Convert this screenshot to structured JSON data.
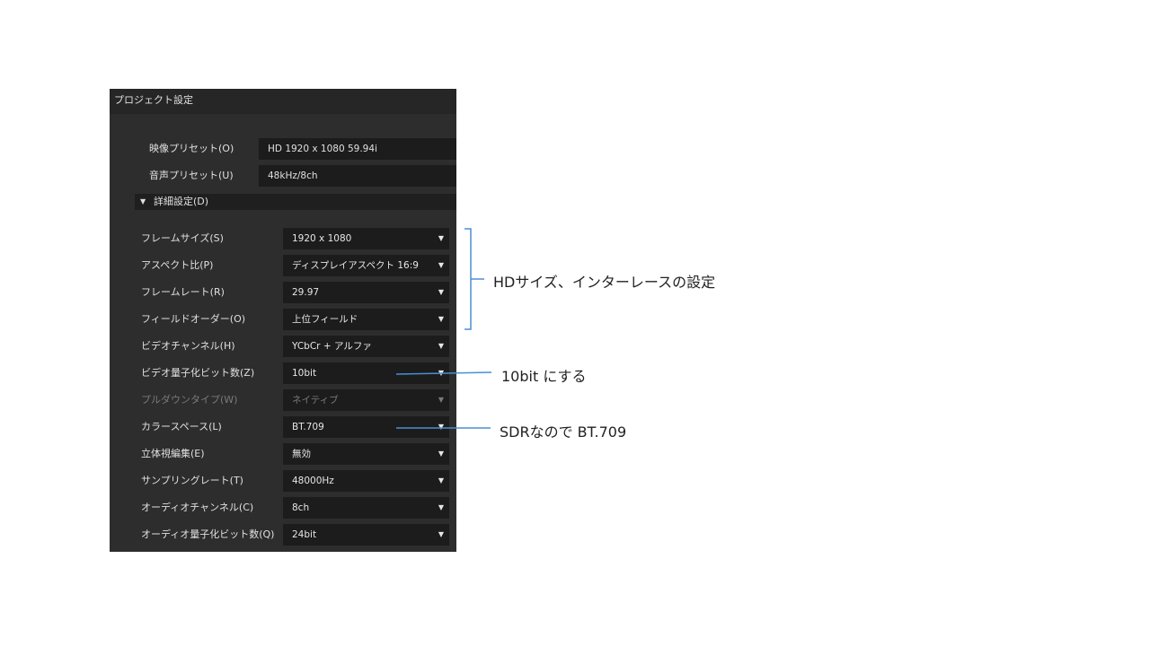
{
  "dialog": {
    "title": "プロジェクト設定",
    "video_preset": {
      "label": "映像プリセット(O)",
      "value": "HD 1920 x 1080 59.94i"
    },
    "audio_preset": {
      "label": "音声プリセット(U)",
      "value": "48kHz/8ch"
    },
    "details_header": "詳細設定(D)",
    "rows": [
      {
        "label": "フレームサイズ(S)",
        "value": "1920 x 1080",
        "enabled": true
      },
      {
        "label": "アスペクト比(P)",
        "value": "ディスプレイアスペクト 16:9",
        "enabled": true
      },
      {
        "label": "フレームレート(R)",
        "value": "29.97",
        "enabled": true
      },
      {
        "label": "フィールドオーダー(O)",
        "value": "上位フィールド",
        "enabled": true
      },
      {
        "label": "ビデオチャンネル(H)",
        "value": "YCbCr + アルファ",
        "enabled": true
      },
      {
        "label": "ビデオ量子化ビット数(Z)",
        "value": "10bit",
        "enabled": true
      },
      {
        "label": "プルダウンタイプ(W)",
        "value": "ネイティブ",
        "enabled": false
      },
      {
        "label": "カラースペース(L)",
        "value": "BT.709",
        "enabled": true
      },
      {
        "label": "立体視編集(E)",
        "value": "無効",
        "enabled": true
      },
      {
        "label": "サンプリングレート(T)",
        "value": "48000Hz",
        "enabled": true
      },
      {
        "label": "オーディオチャンネル(C)",
        "value": "8ch",
        "enabled": true
      },
      {
        "label": "オーディオ量子化ビット数(Q)",
        "value": "24bit",
        "enabled": true
      }
    ]
  },
  "annotations": {
    "hd_interlace": "HDサイズ、インターレースの設定",
    "bit10": "10bit にする",
    "sdr": "SDRなので BT.709"
  },
  "colors": {
    "panel_bg": "#2d2d2d",
    "field_bg": "#1c1c1c",
    "annotation_line": "#4a8fd4"
  },
  "icons": {
    "dropdown": "triangle-down-icon",
    "section_toggle": "triangle-down-icon"
  }
}
